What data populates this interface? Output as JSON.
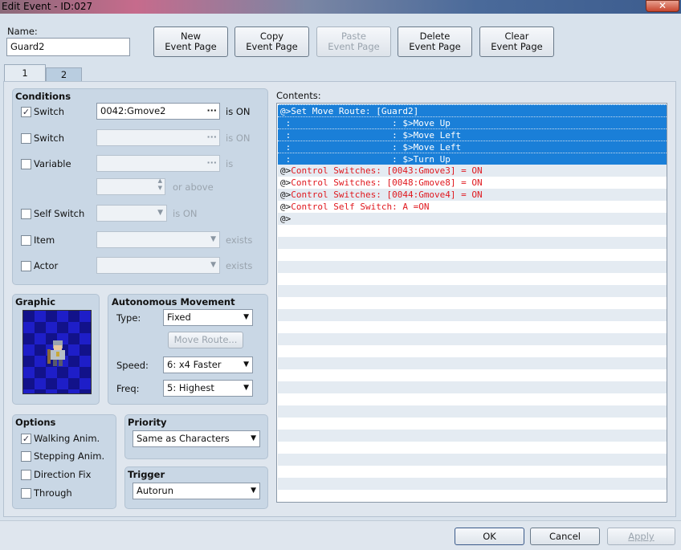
{
  "window": {
    "title": "Edit Event - ID:027",
    "close_icon": "close-icon"
  },
  "name": {
    "label": "Name:",
    "value": "Guard2"
  },
  "toolbar": {
    "new": "New\nEvent Page",
    "copy": "Copy\nEvent Page",
    "paste": "Paste\nEvent Page",
    "delete": "Delete\nEvent Page",
    "clear": "Clear\nEvent Page"
  },
  "tabs": [
    "1",
    "2"
  ],
  "conditions": {
    "title": "Conditions",
    "switch1": {
      "label": "Switch",
      "value": "0042:Gmove2",
      "suffix": "is ON",
      "checked": true
    },
    "switch2": {
      "label": "Switch",
      "value": "",
      "suffix": "is ON"
    },
    "variable": {
      "label": "Variable",
      "value": "",
      "suffix": "is",
      "or_above": "or above"
    },
    "self_switch": {
      "label": "Self Switch",
      "suffix": "is ON"
    },
    "item": {
      "label": "Item",
      "suffix": "exists"
    },
    "actor": {
      "label": "Actor",
      "suffix": "exists"
    }
  },
  "graphic": {
    "title": "Graphic"
  },
  "autonomous": {
    "title": "Autonomous Movement",
    "type_label": "Type:",
    "type_value": "Fixed",
    "move_route": "Move Route...",
    "speed_label": "Speed:",
    "speed_value": "6: x4 Faster",
    "freq_label": "Freq:",
    "freq_value": "5: Highest"
  },
  "options": {
    "title": "Options",
    "walking": "Walking Anim.",
    "stepping": "Stepping Anim.",
    "direction_fix": "Direction Fix",
    "through": "Through"
  },
  "priority": {
    "title": "Priority",
    "value": "Same as Characters"
  },
  "trigger": {
    "title": "Trigger",
    "value": "Autorun"
  },
  "contents": {
    "label": "Contents:",
    "lines": [
      "@>Set Move Route: [Guard2]",
      " :                   : $>Move Up",
      " :                   : $>Move Left",
      " :                   : $>Move Left",
      " :                   : $>Turn Up",
      "@>",
      "Control Switches: [0043:Gmove3] = ON",
      "@>",
      "Control Switches: [0048:Gmove8] = ON",
      "@>",
      "Control Switches: [0044:Gmove4] = ON",
      "@>",
      "Control Self Switch: A =ON",
      "@>"
    ]
  },
  "footer": {
    "ok": "OK",
    "cancel": "Cancel",
    "apply": "Apply"
  }
}
